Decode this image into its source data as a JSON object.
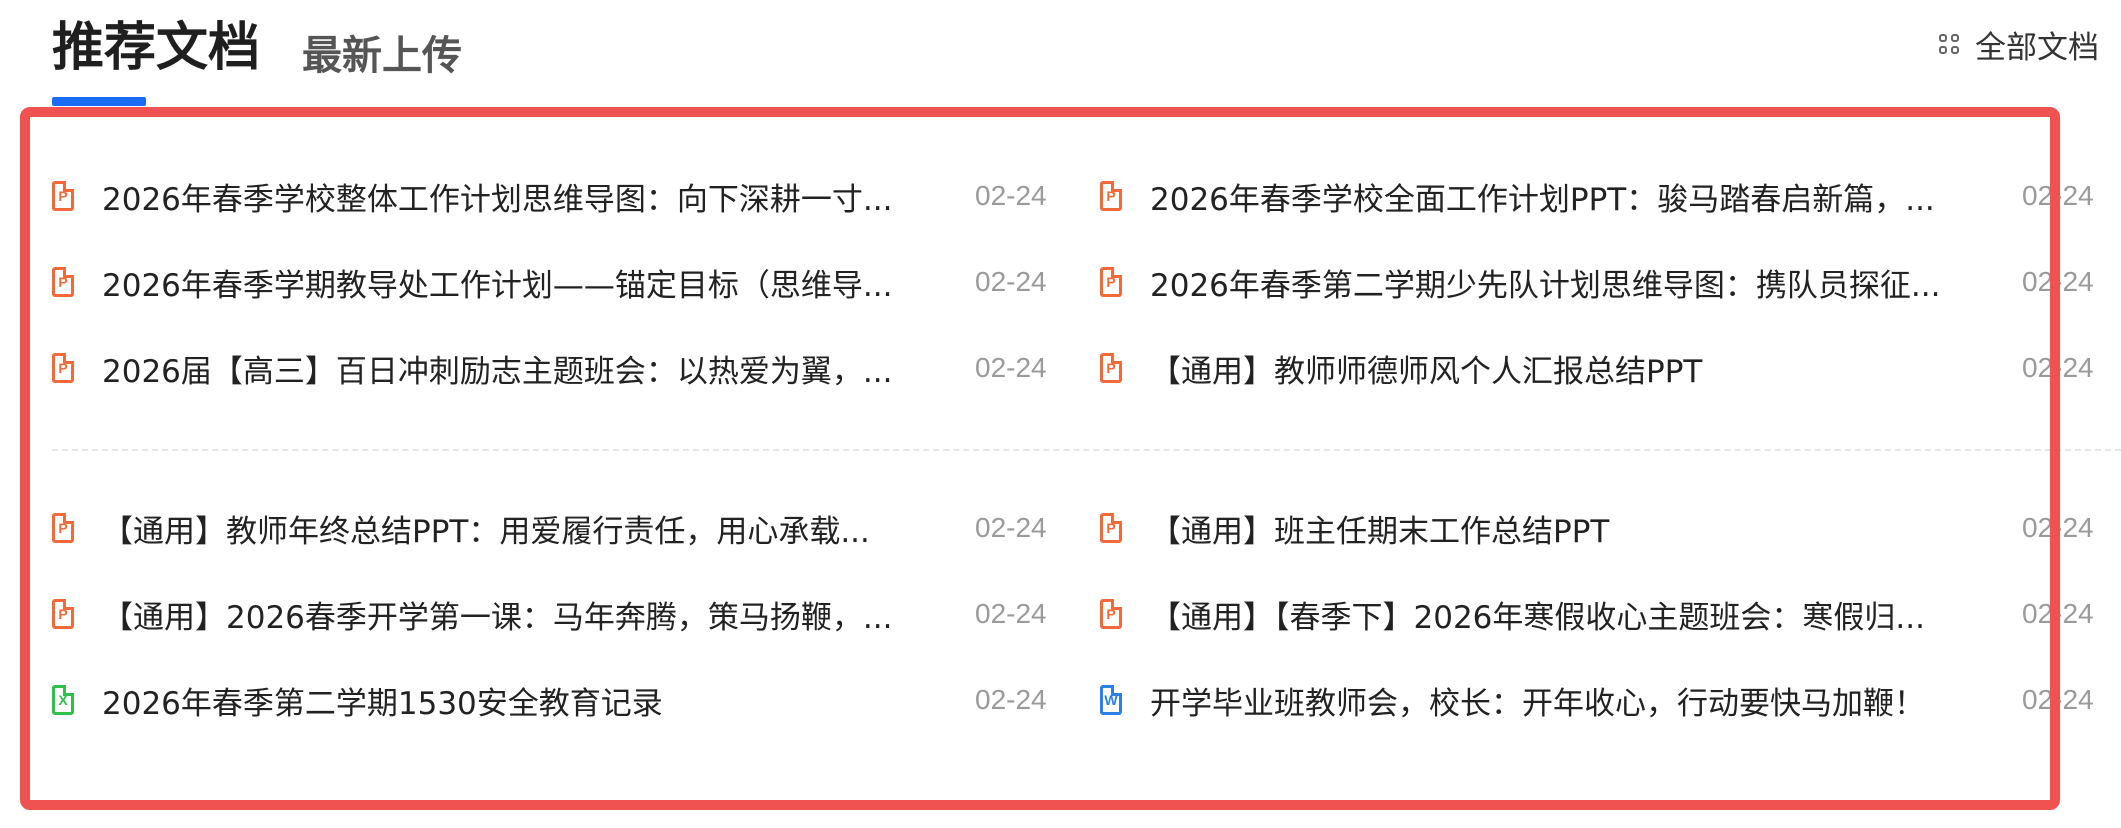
{
  "tabs": [
    {
      "label": "推荐文档",
      "active": true
    },
    {
      "label": "最新上传",
      "active": false
    }
  ],
  "header": {
    "all_docs_label": "全部文档",
    "all_docs_icon": "grid-icon"
  },
  "colors": {
    "accent": "#1a6cf5",
    "highlight_frame": "#f05252",
    "ppt_icon": "#f26a3a",
    "xls_icon": "#2ec04a",
    "doc_icon": "#2f7fe8",
    "date_text": "#9a9a9a"
  },
  "groups": [
    {
      "rows": [
        {
          "left": {
            "type": "ppt",
            "icon": "ppt-file-icon",
            "title": "2026年春季学校整体工作计划思维导图：向下深耕一寸...",
            "date": "02-24"
          },
          "right": {
            "type": "ppt",
            "icon": "ppt-file-icon",
            "title": "2026年春季学校全面工作计划PPT：骏马踏春启新篇，...",
            "date": "02-24"
          }
        },
        {
          "left": {
            "type": "ppt",
            "icon": "ppt-file-icon",
            "title": "2026年春季学期教导处工作计划——锚定目标（思维导...",
            "date": "02-24"
          },
          "right": {
            "type": "ppt",
            "icon": "ppt-file-icon",
            "title": "2026年春季第二学期少先队计划思维导图：携队员探征...",
            "date": "02-24"
          }
        },
        {
          "left": {
            "type": "ppt",
            "icon": "ppt-file-icon",
            "title": "2026届【高三】百日冲刺励志主题班会：以热爱为翼，...",
            "date": "02-24"
          },
          "right": {
            "type": "ppt",
            "icon": "ppt-file-icon",
            "title": "【通用】教师师德师风个人汇报总结PPT",
            "date": "02-24"
          }
        }
      ]
    },
    {
      "rows": [
        {
          "left": {
            "type": "ppt",
            "icon": "ppt-file-icon",
            "title": "【通用】教师年终总结PPT：用爱履行责任，用心承载...",
            "date": "02-24"
          },
          "right": {
            "type": "ppt",
            "icon": "ppt-file-icon",
            "title": "【通用】班主任期末工作总结PPT",
            "date": "02-24"
          }
        },
        {
          "left": {
            "type": "ppt",
            "icon": "ppt-file-icon",
            "title": "【通用】2026春季开学第一课：马年奔腾，策马扬鞭，...",
            "date": "02-24"
          },
          "right": {
            "type": "ppt",
            "icon": "ppt-file-icon",
            "title": "【通用】【春季下】2026年寒假收心主题班会：寒假归...",
            "date": "02-24"
          }
        },
        {
          "left": {
            "type": "xls",
            "icon": "excel-file-icon",
            "title": "2026年春季第二学期1530安全教育记录",
            "date": "02-24"
          },
          "right": {
            "type": "doc",
            "icon": "word-file-icon",
            "title": "开学毕业班教师会，校长：开年收心，行动要快马加鞭！",
            "date": "02-24"
          }
        }
      ]
    }
  ]
}
